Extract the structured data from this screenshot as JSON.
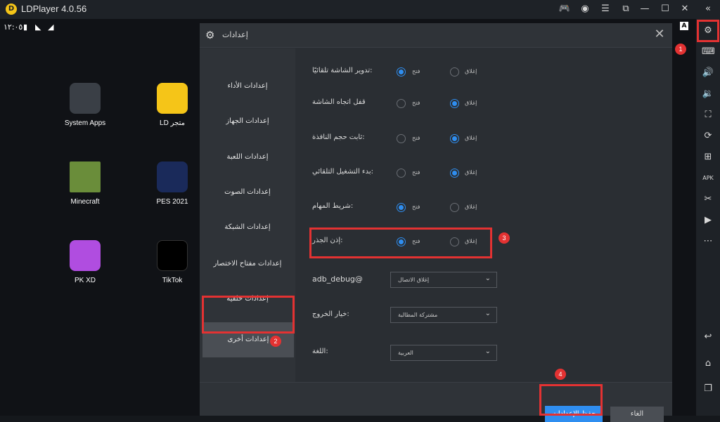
{
  "window": {
    "title": "LDPlayer 4.0.56",
    "logo": "D"
  },
  "statusbar": {
    "time": "١٢:٠٥"
  },
  "home_apps": [
    {
      "label": "System Apps",
      "icon": "system-apps-icon"
    },
    {
      "label": "LD متجر",
      "icon": "ld-store-icon"
    },
    {
      "label": "Minecraft",
      "icon": "minecraft-icon"
    },
    {
      "label": "PES 2021",
      "icon": "pes-2021-icon"
    },
    {
      "label": "PK XD",
      "icon": "pk-xd-icon"
    },
    {
      "label": "TikTok",
      "icon": "tiktok-icon"
    }
  ],
  "dialog": {
    "title": "إعدادات",
    "sidebar": [
      {
        "label": "إعدادات الأداء"
      },
      {
        "label": "إعدادات الجهاز"
      },
      {
        "label": "إعدادات اللعبة"
      },
      {
        "label": "إعدادات الصوت"
      },
      {
        "label": "إعدادات الشبكة"
      },
      {
        "label": "إعدادات مفتاح الاختصار"
      },
      {
        "label": "إعدادات خلفية"
      },
      {
        "label": "إعدادات أخرى",
        "active": true
      }
    ],
    "options": [
      {
        "label": "تدوير الشاشة تلقائيًا:",
        "open": "فتح",
        "close": "إغلاق",
        "selected": "open"
      },
      {
        "label": "قفل اتجاه الشاشة",
        "open": "فتح",
        "close": "إغلاق",
        "selected": "close"
      },
      {
        "label": "ثابت حجم النافذة:",
        "open": "فتح",
        "close": "إغلاق",
        "selected": "close"
      },
      {
        "label": "بدء التشغيل التلقائي:",
        "open": "فتح",
        "close": "إغلاق",
        "selected": "close"
      },
      {
        "label": "شريط المهام:",
        "open": "فتح",
        "close": "إغلاق",
        "selected": "open"
      },
      {
        "label": "إذن الجذر:",
        "open": "فتح",
        "close": "إغلاق",
        "selected": "open"
      }
    ],
    "selects": [
      {
        "label": "adb_debug@",
        "value": "إغلاق الاتصال"
      },
      {
        "label": "خيار الخروج:",
        "value": "مشتركة المطالبة"
      },
      {
        "label": "اللغة:",
        "value": "العربية"
      }
    ],
    "save_label": "حفظ الإعدادات",
    "cancel_label": "الغاء"
  },
  "annotations": [
    "1",
    "2",
    "3",
    "4"
  ],
  "colors": {
    "accent": "#2f8ef0",
    "highlight": "#e33232"
  }
}
